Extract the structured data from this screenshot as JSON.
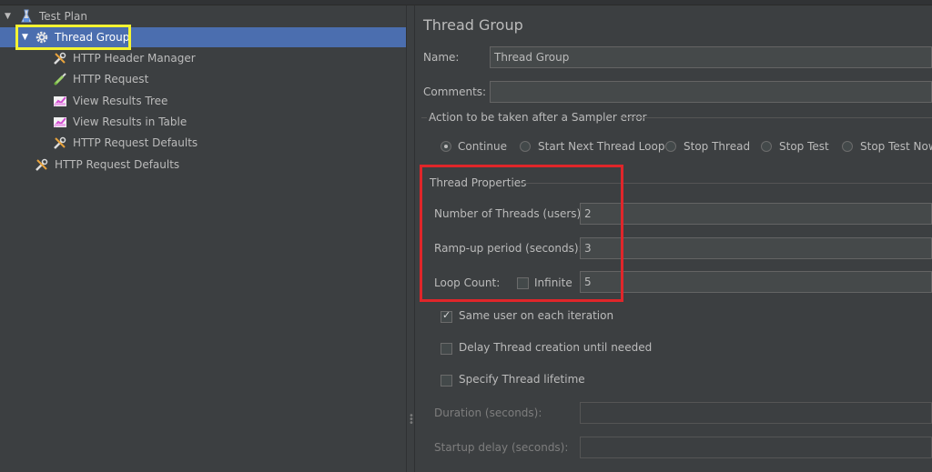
{
  "tree": {
    "items": [
      {
        "label": "Test Plan",
        "icon": "test-plan-icon"
      },
      {
        "label": "Thread Group",
        "icon": "gear-icon"
      },
      {
        "label": "HTTP Header Manager",
        "icon": "wrench-icon"
      },
      {
        "label": "HTTP Request",
        "icon": "pipette-icon"
      },
      {
        "label": "View Results Tree",
        "icon": "chart-icon"
      },
      {
        "label": "View Results in Table",
        "icon": "chart-icon"
      },
      {
        "label": "HTTP Request Defaults",
        "icon": "wrench-icon"
      },
      {
        "label": "HTTP Request Defaults",
        "icon": "wrench-icon"
      }
    ]
  },
  "form": {
    "title": "Thread Group",
    "name_label": "Name:",
    "name_value": "Thread Group",
    "comments_label": "Comments:",
    "comments_value": "",
    "sampler_error": {
      "legend": "Action to be taken after a Sampler error",
      "options": [
        "Continue",
        "Start Next Thread Loop",
        "Stop Thread",
        "Stop Test",
        "Stop Test Now"
      ],
      "selected": "Continue"
    },
    "thread_properties": {
      "legend": "Thread Properties",
      "threads_label": "Number of Threads (users):",
      "threads_value": "2",
      "rampup_label": "Ramp-up period (seconds):",
      "rampup_value": "3",
      "loop_label": "Loop Count:",
      "infinite_label": "Infinite",
      "infinite_checked": false,
      "loop_value": "5"
    },
    "same_user_label": "Same user on each iteration",
    "same_user_checked": true,
    "delay_label": "Delay Thread creation until needed",
    "delay_checked": false,
    "lifetime_label": "Specify Thread lifetime",
    "lifetime_checked": false,
    "duration_label": "Duration (seconds):",
    "duration_value": "",
    "startup_delay_label": "Startup delay (seconds):",
    "startup_delay_value": ""
  },
  "colors": {
    "selection": "#4b6eaf",
    "highlight_yellow": "#f3f331",
    "highlight_red": "#e0262a",
    "background": "#3c3f41"
  }
}
